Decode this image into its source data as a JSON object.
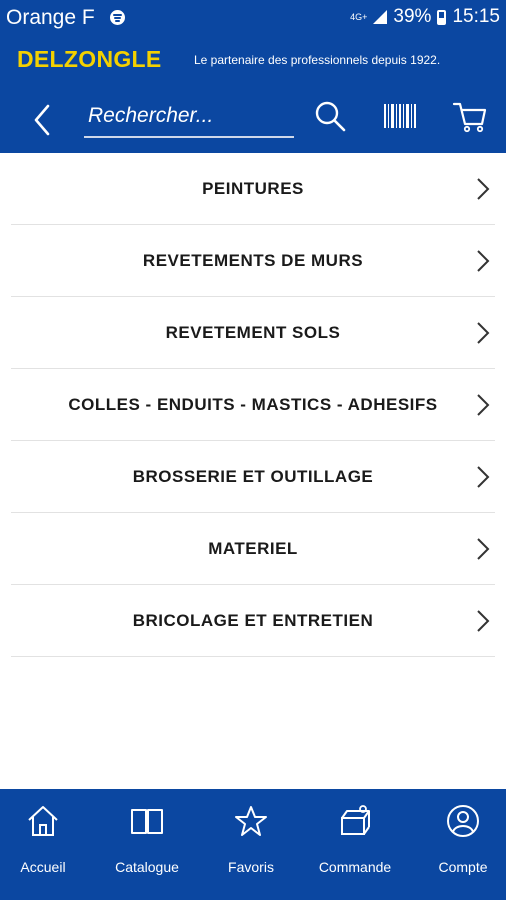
{
  "status_bar": {
    "carrier": "Orange F",
    "network": "4G+",
    "battery": "39%",
    "time": "15:15"
  },
  "brand": {
    "logo": "DELZONGLE",
    "tagline": "Le partenaire des professionnels depuis 1922.",
    "primary_color": "#0b47a1",
    "logo_color": "#f4d100"
  },
  "search": {
    "placeholder": "Rechercher..."
  },
  "nav_icons": [
    "back-chevron-icon",
    "search-icon",
    "barcode-icon",
    "cart-icon"
  ],
  "categories": [
    {
      "label": "PEINTURES"
    },
    {
      "label": "REVETEMENTS DE MURS"
    },
    {
      "label": "REVETEMENT SOLS"
    },
    {
      "label": "COLLES - ENDUITS - MASTICS - ADHESIFS"
    },
    {
      "label": "BROSSERIE ET OUTILLAGE"
    },
    {
      "label": "MATERIEL"
    },
    {
      "label": "BRICOLAGE ET ENTRETIEN"
    }
  ],
  "tabs": [
    {
      "label": "Accueil",
      "icon": "home-icon"
    },
    {
      "label": "Catalogue",
      "icon": "book-icon"
    },
    {
      "label": "Favoris",
      "icon": "star-icon"
    },
    {
      "label": "Commande",
      "icon": "order-icon"
    },
    {
      "label": "Compte",
      "icon": "account-icon"
    }
  ]
}
